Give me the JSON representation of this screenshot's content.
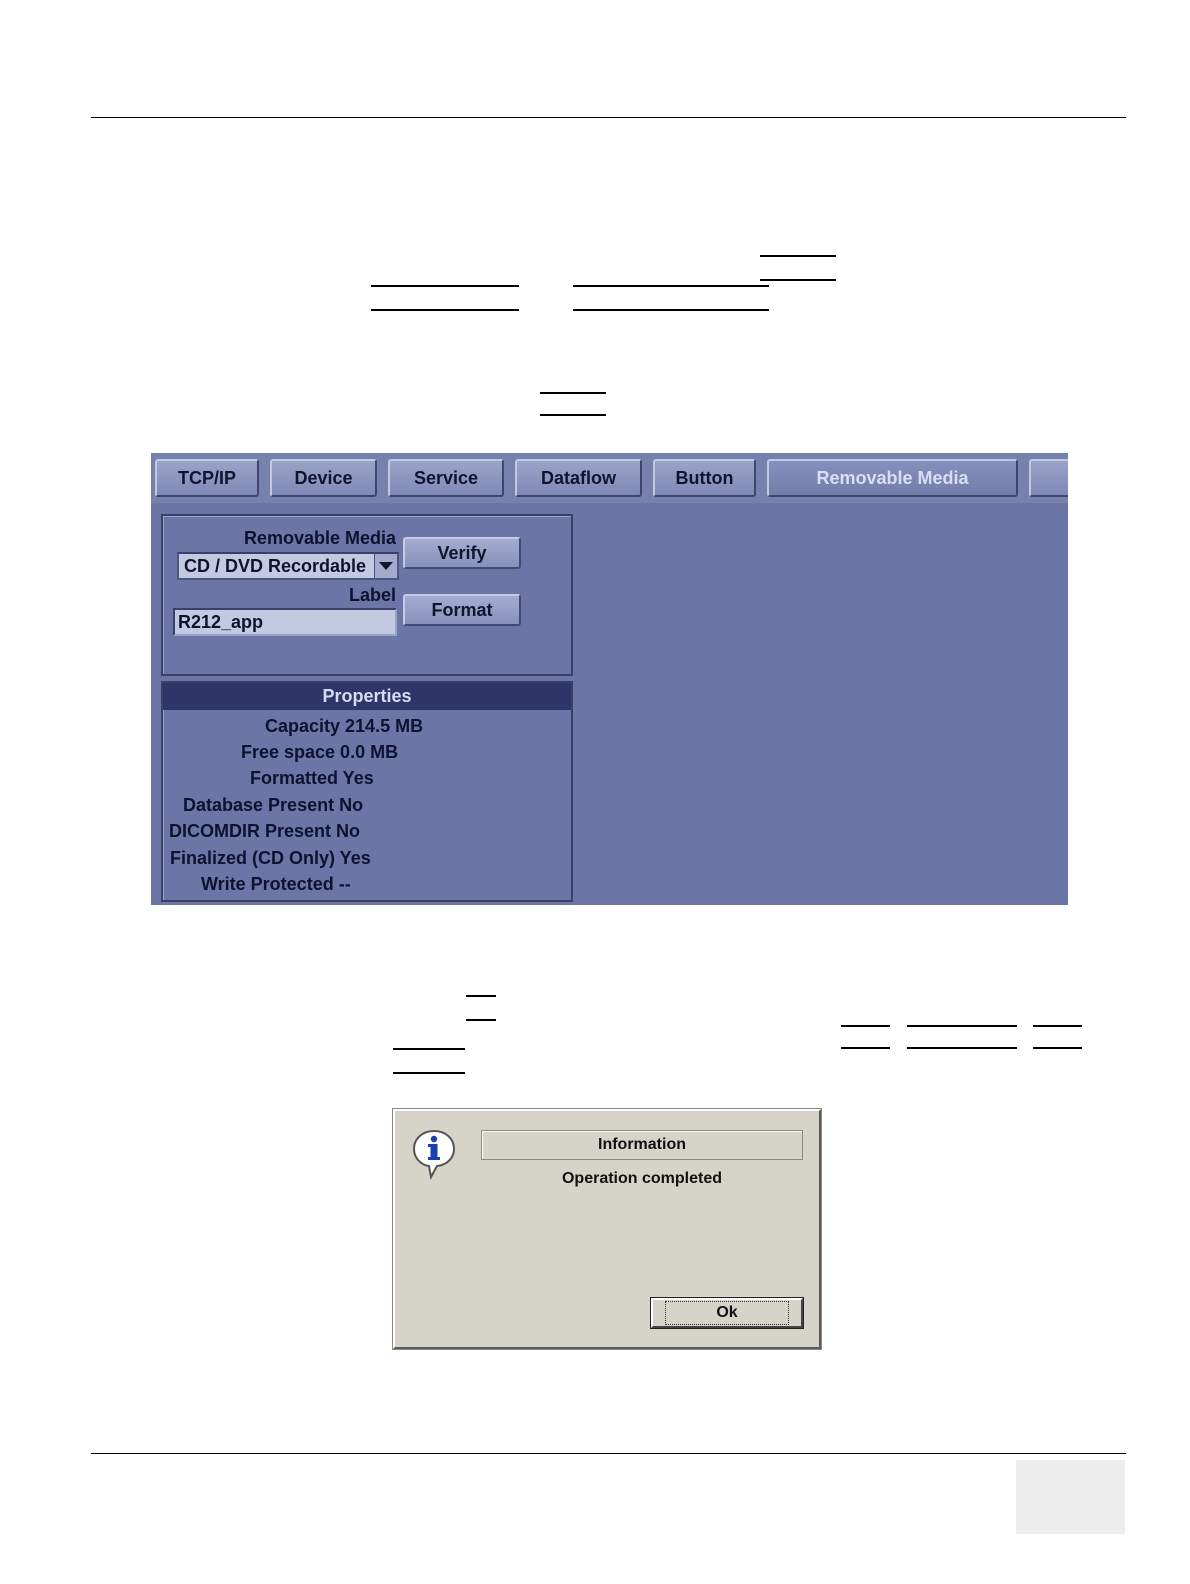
{
  "utility_panel": {
    "tabs": [
      "TCP/IP",
      "Device",
      "Service",
      "Dataflow",
      "Button",
      "Removable Media"
    ],
    "active_tab": "Removable Media",
    "media": {
      "removable_media_label": "Removable Media",
      "selected_media": "CD / DVD Recordable",
      "label_label": "Label",
      "label_value": "R212_app",
      "verify_button": "Verify",
      "format_button": "Format"
    },
    "properties": {
      "title": "Properties",
      "rows": [
        "Capacity 214.5 MB",
        "Free space 0.0 MB",
        "Formatted Yes",
        "Database Present No",
        "DICOMDIR Present No",
        "Finalized (CD Only) Yes",
        "Write Protected --"
      ]
    }
  },
  "info_dialog": {
    "title": "Information",
    "message": "Operation completed",
    "ok_button": "Ok",
    "icon": "info-speech-bubble-icon"
  }
}
